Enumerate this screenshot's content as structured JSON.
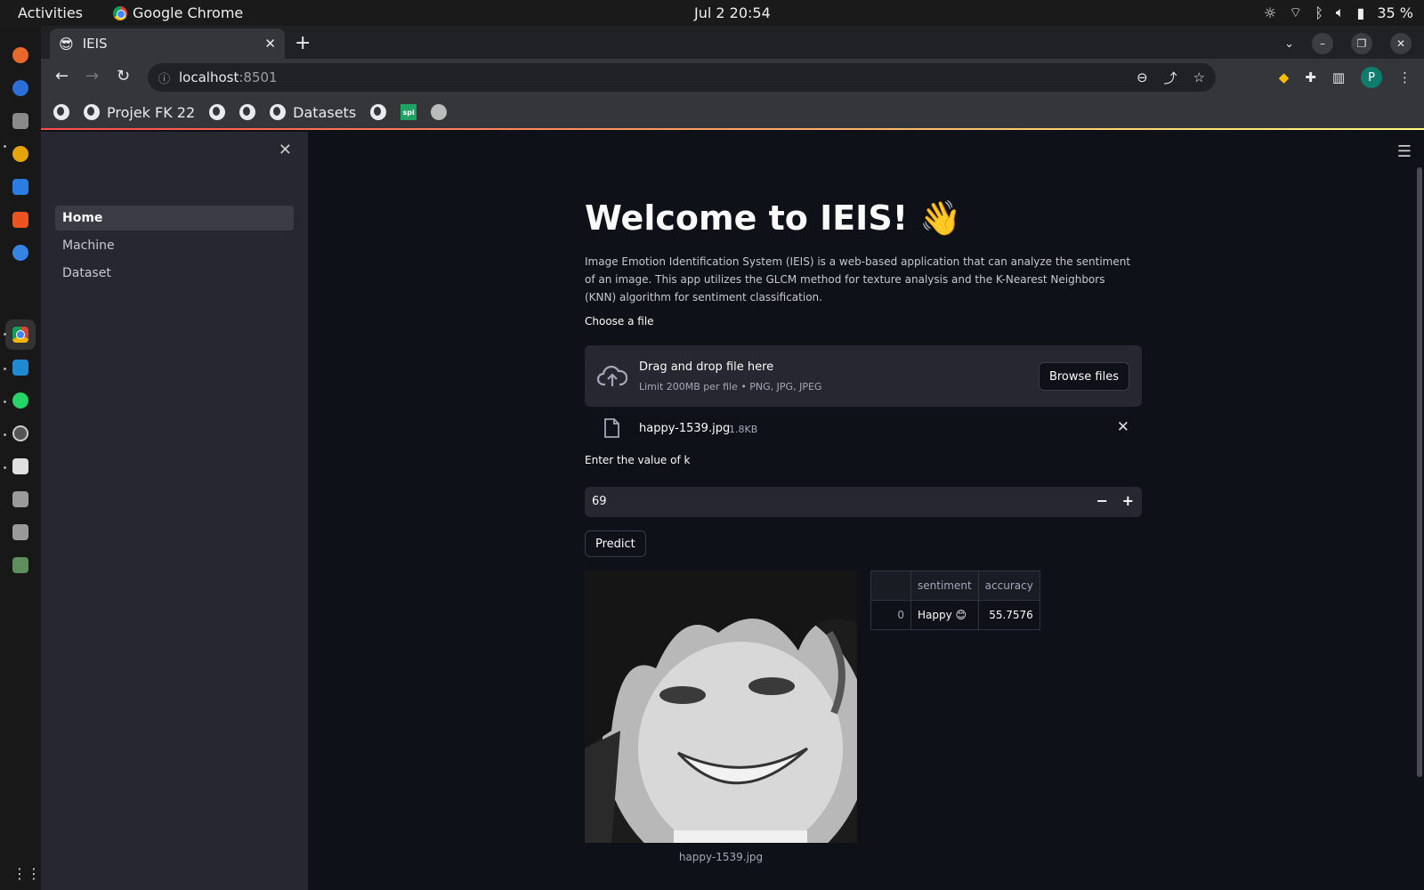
{
  "system": {
    "activities": "Activities",
    "app_name": "Google Chrome",
    "clock": "Jul 2  20:54",
    "battery": "35 %"
  },
  "browser": {
    "tab_title": "IEIS",
    "tab_favicon": "😎",
    "url_host": "localhost",
    "url_port": ":8501",
    "profile_initial": "P",
    "bookmarks": [
      "Projek FK 22",
      "Datasets"
    ]
  },
  "sidebar": {
    "items": [
      {
        "label": "Home",
        "active": true
      },
      {
        "label": "Machine",
        "active": false
      },
      {
        "label": "Dataset",
        "active": false
      }
    ]
  },
  "page": {
    "title": "Welcome to IEIS! 👋",
    "intro": "Image Emotion Identification System (IEIS) is a web-based application that can analyze the sentiment of an image. This app utilizes the GLCM method for texture analysis and the K-Nearest Neighbors (KNN) algorithm for sentiment classification.",
    "uploader": {
      "label": "Choose a file",
      "drop_title": "Drag and drop file here",
      "limit": "Limit 200MB per file • PNG, JPG, JPEG",
      "browse_label": "Browse files",
      "file_name": "happy-1539.jpg",
      "file_size": "1.8KB"
    },
    "k_input": {
      "label": "Enter the value of k",
      "value": "69",
      "minus": "−",
      "plus": "+"
    },
    "predict_label": "Predict",
    "image_caption": "happy-1539.jpg",
    "result_table": {
      "columns": [
        "",
        "sentiment",
        "accuracy"
      ],
      "rows": [
        {
          "index": "0",
          "sentiment": "Happy 😊",
          "accuracy": "55.7576"
        }
      ]
    }
  },
  "colors": {
    "app_bg": "#0e1117",
    "sidebar_bg": "#262730",
    "accent_gradient_start": "#ff4b4b",
    "accent_gradient_end": "#fffd80"
  }
}
